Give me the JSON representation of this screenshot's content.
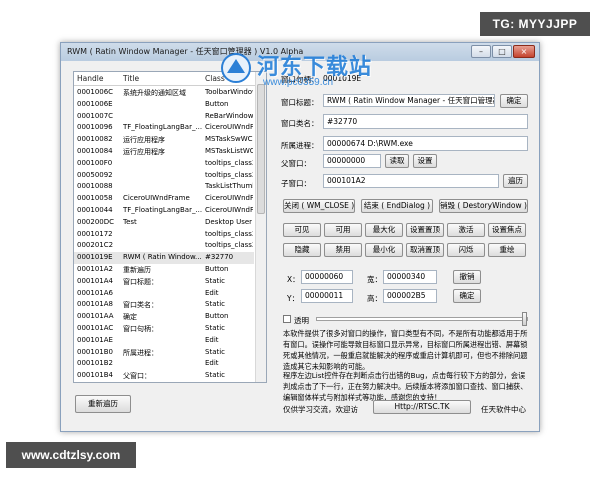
{
  "banners": {
    "tg": "TG: MYYJJPP",
    "site": "www.cdtzlsy.com"
  },
  "watermark": {
    "logo_text": "河东下载站",
    "url": "www.pc0359.cn"
  },
  "window": {
    "title": "RWM ( Ratin Window Manager - 任天窗口管理器 ) V1.0 Alpha",
    "controls": {
      "minimize": "–",
      "maximize": "□",
      "close": "×"
    }
  },
  "list": {
    "headers": [
      "Handle",
      "Title",
      "Class"
    ],
    "rows": [
      [
        "0001006C",
        "系统升级的通知区域",
        "ToolbarWindow32"
      ],
      [
        "0001006E",
        "",
        "Button"
      ],
      [
        "0001007C",
        "",
        "ReBarWindow32"
      ],
      [
        "00010096",
        "TF_FloatingLangBar_...",
        "CiceroUIWndFrame"
      ],
      [
        "00010082",
        "运行应用程序",
        "MSTaskSwWClass"
      ],
      [
        "00010084",
        "运行应用程序",
        "MSTaskListWClass"
      ],
      [
        "000100F0",
        "",
        "tooltips_class32"
      ],
      [
        "00050092",
        "",
        "tooltips_class32"
      ],
      [
        "00010088",
        "",
        "TaskListThumbnail"
      ],
      [
        "00010058",
        "CiceroUIWndFrame",
        "CiceroUIWndFrame"
      ],
      [
        "00010044",
        "TF_FloatingLangBar_...",
        "CiceroUIWndFrame"
      ],
      [
        "000200DC",
        "Test",
        "Desktop User Pic"
      ],
      [
        "00010172",
        "",
        "tooltips_class32"
      ],
      [
        "000201C2",
        "",
        "tooltips_class32"
      ],
      [
        "0001019E",
        "RWM ( Ratin Window...",
        "#32770"
      ],
      [
        "000101A2",
        "重新遍历",
        "Button"
      ],
      [
        "000101A4",
        "窗口标题：",
        "Static"
      ],
      [
        "000101A6",
        "",
        "Edit"
      ],
      [
        "000101A8",
        "窗口类名：",
        "Static"
      ],
      [
        "000101AA",
        "确定",
        "Button"
      ],
      [
        "000101AC",
        "窗口句柄：",
        "Static"
      ],
      [
        "000101AE",
        "",
        "Edit"
      ],
      [
        "000101B0",
        "所属进程：",
        "Static"
      ],
      [
        "000101B2",
        "",
        "Edit"
      ],
      [
        "000101B4",
        "父窗口：",
        "Static"
      ]
    ],
    "selected_index": 14
  },
  "fields": {
    "handle_label": "窗口句柄：",
    "handle_value": "0001019E",
    "title_label": "窗口标题：",
    "title_value": "RWM ( Ratin Window Manager - 任天窗口管理器 )",
    "confirm": "确定",
    "class_label": "窗口类名：",
    "class_value": "#32770",
    "process_label": "所属进程：",
    "process_value": "00000674 D:\\RWM.exe",
    "parent_label": "父窗口：",
    "parent_value": "00000000",
    "read": "读取",
    "set": "设置",
    "child_label": "子窗口：",
    "child_value": "000101A2",
    "traverse": "遍历"
  },
  "actions": {
    "close_wm": "关闭 ( WM_CLOSE )",
    "end_dialog": "结束 ( EndDialog )",
    "destroy": "销毁 ( DestoryWindow )",
    "grid": [
      [
        "可见",
        "可用",
        "最大化",
        "设置置顶",
        "激活",
        "设置焦点"
      ],
      [
        "隐藏",
        "禁用",
        "最小化",
        "取消置顶",
        "闪烁",
        "重绘"
      ]
    ]
  },
  "position": {
    "x_label": "X：",
    "x_value": "00000060",
    "w_label": "宽：",
    "w_value": "00000340",
    "y_label": "Y：",
    "y_value": "00000011",
    "h_label": "高：",
    "h_value": "000002B5",
    "undo": "撤销",
    "ok": "确定"
  },
  "transparency": {
    "label": "透明",
    "checked": false,
    "level": 1.0
  },
  "description": {
    "para1": "本软件提供了很多对窗口的操作，窗口类型有不同，不是所有功能都适用于所有窗口。误操作可能导致目标窗口显示异常，目标窗口所属进程出错、屏幕锁死或其他情况，一般重启就能解决的程序或重启计算机即可，但也不排除问题造成其它未知影响的可能。",
    "para2": "程序左边List控件存在判断点击行出错的Bug，点击每行较下方的部分，会误判成点击了下一行，正在努力解决中。后续版本将添加窗口查找、窗口捕获、编辑窗体样式与附加样式等功能，感谢您的支持！"
  },
  "footer": {
    "refresh": "重新遍历",
    "exchange": "仅供学习交流，欢迎访",
    "link": "Http://RTSC.TK",
    "center": "任天软件中心"
  }
}
